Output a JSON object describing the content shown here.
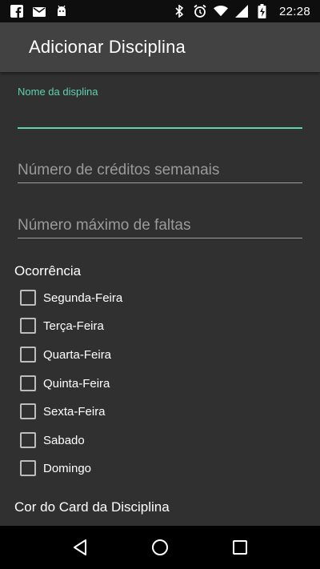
{
  "status_bar": {
    "time": "22:28",
    "left_icons": [
      "facebook-icon",
      "mail-icon",
      "android-icon"
    ],
    "right_icons": [
      "bluetooth-icon",
      "alarm-icon",
      "wifi-icon",
      "signal-icon",
      "battery-icon"
    ]
  },
  "app_bar": {
    "title": "Adicionar Disciplina"
  },
  "form": {
    "name_field": {
      "label": "Nome da displina",
      "value": ""
    },
    "credits_field": {
      "placeholder": "Número de créditos semanais",
      "value": ""
    },
    "absences_field": {
      "placeholder": "Número máximo de faltas",
      "value": ""
    }
  },
  "occurrence": {
    "title": "Ocorrência",
    "days": [
      {
        "label": "Segunda-Feira",
        "checked": false
      },
      {
        "label": "Terça-Feira",
        "checked": false
      },
      {
        "label": "Quarta-Feira",
        "checked": false
      },
      {
        "label": "Quinta-Feira",
        "checked": false
      },
      {
        "label": "Sexta-Feira",
        "checked": false
      },
      {
        "label": "Sabado",
        "checked": false
      },
      {
        "label": "Domingo",
        "checked": false
      }
    ]
  },
  "card_color": {
    "title": "Cor do Card da Disciplina"
  },
  "navigation": {
    "buttons": [
      "back-icon",
      "home-icon",
      "recents-icon"
    ]
  },
  "colors": {
    "accent": "#5fd3b0",
    "background": "#303030",
    "app_bar": "#424242"
  }
}
